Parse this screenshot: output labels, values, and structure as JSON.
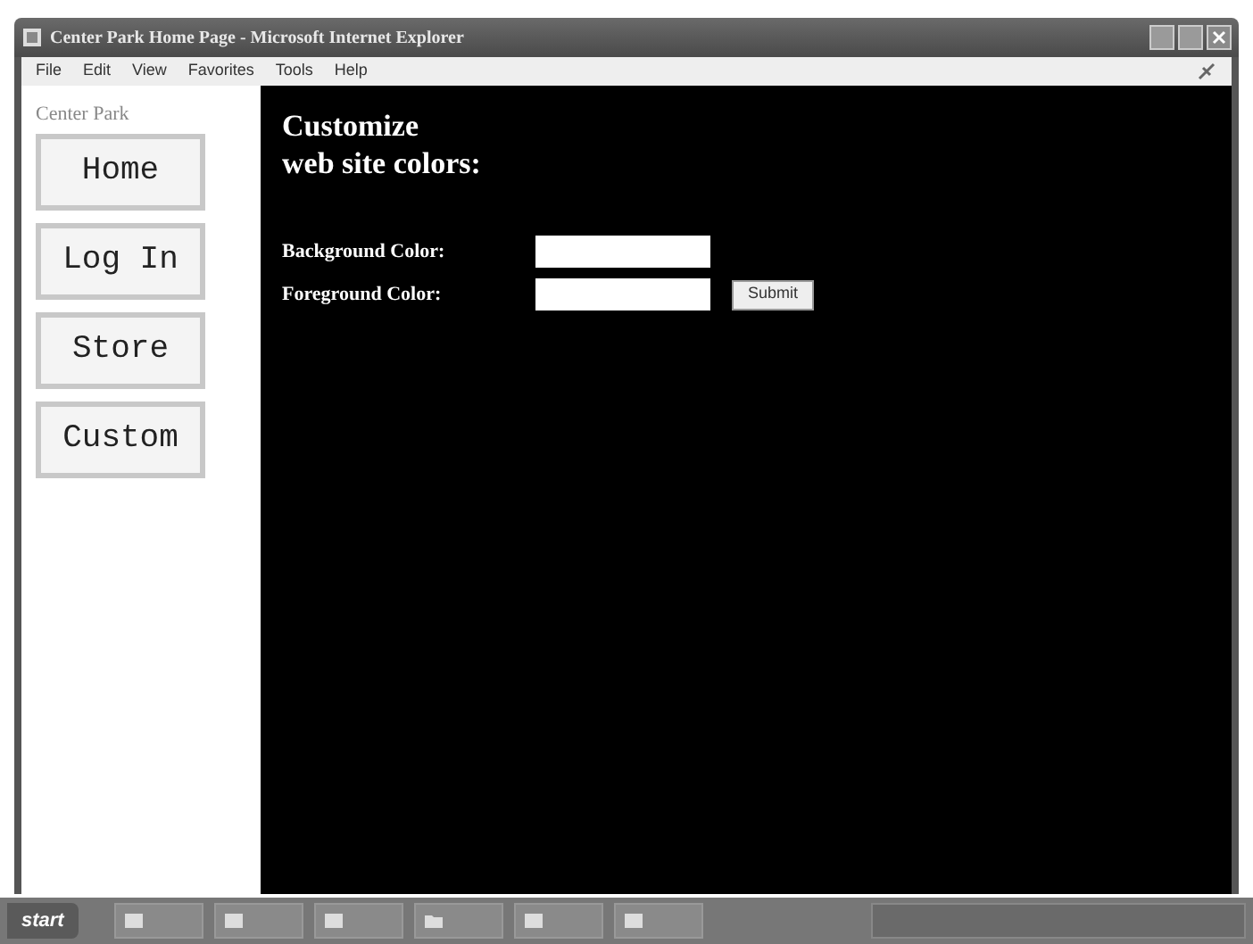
{
  "window": {
    "title": "Center Park Home Page - Microsoft Internet Explorer"
  },
  "menu_bar": [
    "File",
    "Edit",
    "View",
    "Favorites",
    "Tools",
    "Help"
  ],
  "sidebar": {
    "site_name": "Center Park",
    "buttons": [
      "Home",
      "Log In",
      "Store",
      "Custom"
    ]
  },
  "main": {
    "heading_lines": [
      "Customize",
      "web site colors:"
    ],
    "fields": [
      {
        "label": "Background Color:"
      },
      {
        "label": "Foreground Color:"
      }
    ],
    "submit": "Submit"
  },
  "taskbar": {
    "start": "start",
    "items": [
      {
        "kind": "window"
      },
      {
        "kind": "window"
      },
      {
        "kind": "window"
      },
      {
        "kind": "folder"
      },
      {
        "kind": "window"
      },
      {
        "kind": "window"
      }
    ]
  }
}
